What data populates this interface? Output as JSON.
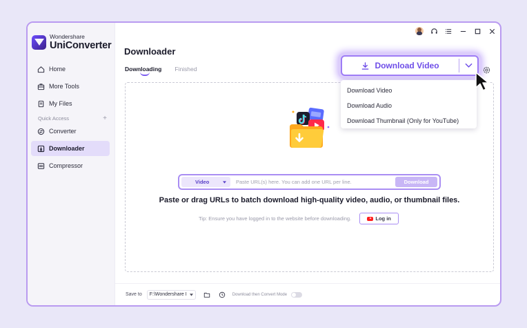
{
  "brand": {
    "small": "Wondershare",
    "big": "UniConverter"
  },
  "sidebar": {
    "items": [
      {
        "label": "Home",
        "icon": "home-icon"
      },
      {
        "label": "More Tools",
        "icon": "toolbox-icon"
      },
      {
        "label": "My Files",
        "icon": "file-icon"
      }
    ],
    "quick_access_label": "Quick Access",
    "quick_items": [
      {
        "label": "Converter",
        "icon": "converter-icon"
      },
      {
        "label": "Downloader",
        "icon": "downloader-icon"
      },
      {
        "label": "Compressor",
        "icon": "compressor-icon"
      }
    ],
    "active": "Downloader"
  },
  "header": {
    "title": "Downloader",
    "tabs": [
      "Downloading",
      "Finished"
    ],
    "active_tab": "Downloading"
  },
  "download_button": {
    "label": "Download Video"
  },
  "menu": {
    "items": [
      "Download Video",
      "Download Audio",
      "Download Thumbnail (Only for YouTube)"
    ]
  },
  "url_bar": {
    "type_value": "Video",
    "placeholder": "Paste URL(s) here. You can add one URL per line.",
    "button_label": "Download"
  },
  "headline": "Paste or drag URLs to batch download high-quality video, audio, or thumbnail files.",
  "tip": "Tip: Ensure you have logged in to the website before downloading.",
  "login_label": "Log in",
  "bottom": {
    "save_to_label": "Save to",
    "path_value": "F:\\Wondershare I",
    "convert_mode_label": "Download then Convert Mode"
  },
  "colors": {
    "accent": "#7b5cf0",
    "accent_light": "#e3dcfa",
    "youtube": "#ff1e1e"
  }
}
